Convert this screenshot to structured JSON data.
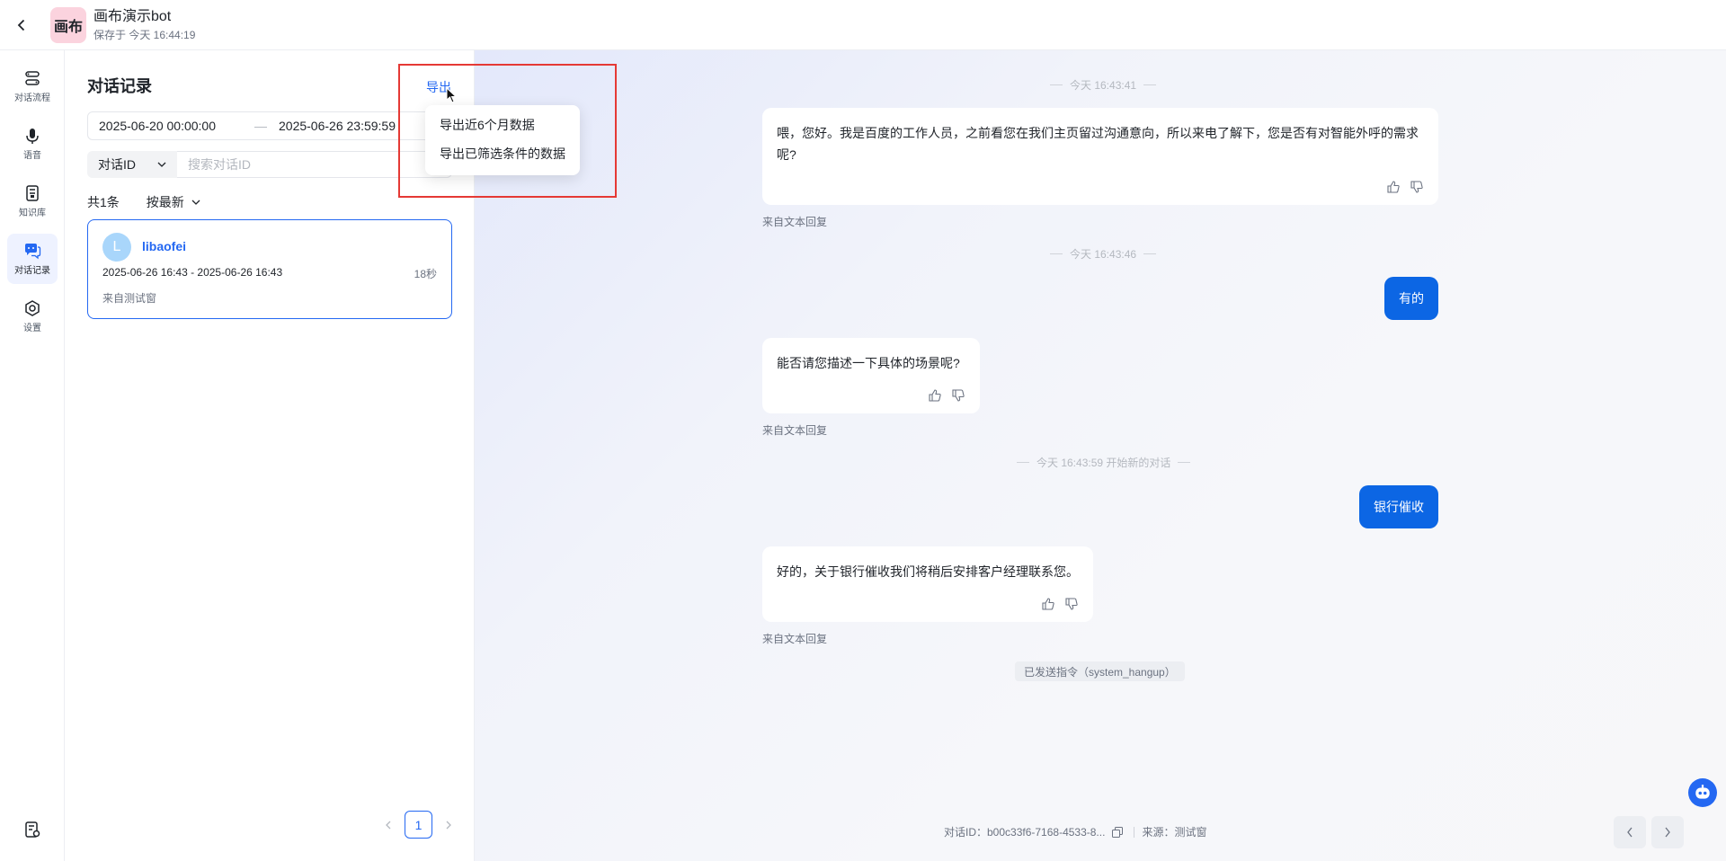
{
  "header": {
    "logo_text": "画布",
    "title": "画布演示bot",
    "saved": "保存于 今天 16:44:19"
  },
  "nav": {
    "items": [
      {
        "label": "对话流程",
        "icon": "flow-icon"
      },
      {
        "label": "语音",
        "icon": "microphone-icon"
      },
      {
        "label": "知识库",
        "icon": "knowledge-base-icon"
      },
      {
        "label": "对话记录",
        "icon": "chat-record-icon",
        "active": true
      },
      {
        "label": "设置",
        "icon": "settings-icon"
      }
    ]
  },
  "list": {
    "title": "对话记录",
    "export_label": "导出",
    "date_start": "2025-06-20 00:00:00",
    "date_sep": "—",
    "date_end": "2025-06-26 23:59:59",
    "filter_type": "对话ID",
    "search_placeholder": "搜索对话ID",
    "count": "共1条",
    "sort": "按最新",
    "records": [
      {
        "avatar": "L",
        "user": "libaofei",
        "time": "2025-06-26 16:43 - 2025-06-26 16:43",
        "duration": "18秒",
        "source": "来自测试窗"
      }
    ],
    "page": "1"
  },
  "dropdown": {
    "items": [
      "导出近6个月数据",
      "导出已筛选条件的数据"
    ]
  },
  "chat": {
    "dividers": [
      "今天 16:43:41",
      "今天 16:43:46",
      "今天 16:43:59 开始新的对话"
    ],
    "messages": [
      {
        "role": "bot",
        "text": "喂，您好。我是百度的工作人员，之前看您在我们主页留过沟通意向，所以来电了解下，您是否有对智能外呼的需求呢?",
        "from": "来自文本回复"
      },
      {
        "role": "user",
        "text": "有的"
      },
      {
        "role": "bot",
        "text": "能否请您描述一下具体的场景呢?",
        "from": "来自文本回复"
      },
      {
        "role": "user",
        "text": "银行催收"
      },
      {
        "role": "bot",
        "text": "好的，关于银行催收我们将稍后安排客户经理联系您。",
        "from": "来自文本回复"
      }
    ],
    "system_command": "已发送指令（system_hangup）",
    "footer": {
      "conversation_id": "对话ID：b00c33f6-7168-4533-8...",
      "source": "来源：测试窗"
    }
  },
  "colors": {
    "accent": "#2468f2",
    "user_bubble": "#0c66e4",
    "highlight": "#e53935"
  }
}
